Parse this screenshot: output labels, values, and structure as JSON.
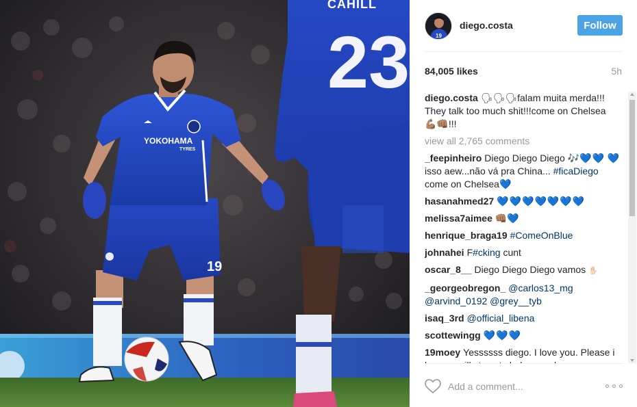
{
  "post": {
    "username": "diego.costa",
    "follow_label": "Follow",
    "likes": "84,005 likes",
    "time_ago": "5h",
    "photo": {
      "front_jersey_number": "19",
      "back_jersey_number": "23",
      "back_jersey_name": "CAHILL",
      "sponsor": "YOKOHAMA",
      "sponsor_sub": "TYRES"
    },
    "caption": {
      "user": "diego.costa",
      "text_a": "falam muita merda!!! They talk too much shit!!!come on Chelsea ",
      "text_b": "!!!"
    },
    "view_all": "view all 2,765 comments",
    "comments": [
      {
        "user": "_feepinheiro",
        "text": "Diego Diego Diego ",
        "hearts": "💙💙",
        "text2": "💙 isso aew...não vá pra China... ",
        "tag": "#ficaDiego",
        "text3": " come on Chelsea",
        "hearts2": "💙"
      },
      {
        "user": "hasanahmed27",
        "hearts": "💙💙💙💙💙💙💙"
      },
      {
        "user": "melissa7aimee",
        "hearts": "💙"
      },
      {
        "user": "henrique_braga19",
        "tag": "#ComeOnBlue"
      },
      {
        "user": "johnahei",
        "text": "F",
        "tag": "#cking",
        "text2": " cunt"
      },
      {
        "user": "oscar_8__",
        "text": "Diego Diego Diego vamos"
      },
      {
        "user": "_georgeobregon_",
        "tag": "@carlos13_mg",
        "tag2": "@arvind_0192",
        "tag3": "@grey__tyb"
      },
      {
        "user": "isaq_3rd",
        "tag": "@official_libena"
      },
      {
        "user": "scottewingg",
        "hearts": "💙💙💙"
      },
      {
        "user": "19moey",
        "text": "Yessssss diego. I love you. Please i know u will stay at chelsea and"
      }
    ],
    "add_comment_placeholder": "Add a comment..."
  },
  "colors": {
    "follow": "#4ba3e6",
    "tag": "#003569",
    "teal_heart": "#21c3c8",
    "kit_blue": "#1d3fa8"
  }
}
